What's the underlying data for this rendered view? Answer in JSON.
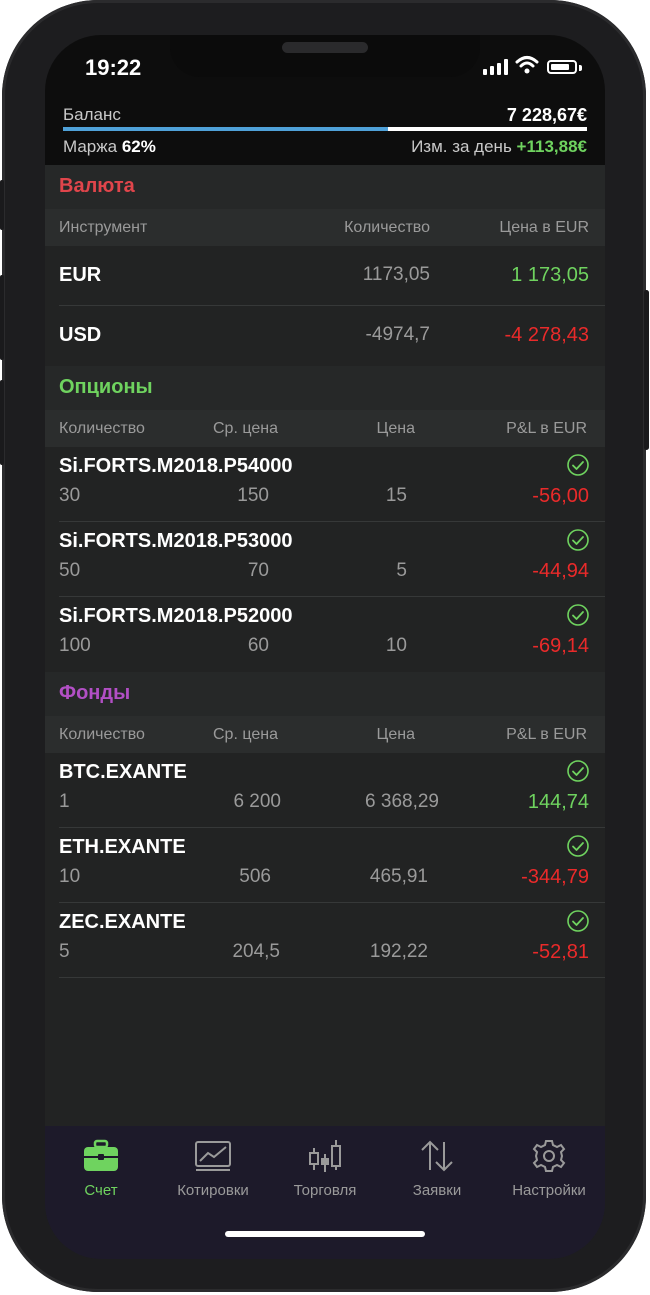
{
  "status": {
    "time": "19:22"
  },
  "balance": {
    "label": "Баланс",
    "value": "7 228,67€",
    "fill_fraction": 0.62
  },
  "margin": {
    "label": "Маржа",
    "value": "62%"
  },
  "day_change": {
    "label": "Изм. за день",
    "value": "+113,88€"
  },
  "currency": {
    "title": "Валюта",
    "headers": {
      "instrument": "Инструмент",
      "quantity": "Количество",
      "price": "Цена в EUR"
    },
    "rows": [
      {
        "name": "EUR",
        "quantity": "1173,05",
        "price": "1 173,05",
        "sign": "pos"
      },
      {
        "name": "USD",
        "quantity": "-4974,7",
        "price": "-4 278,43",
        "sign": "neg"
      }
    ]
  },
  "options": {
    "title": "Опционы",
    "headers": {
      "quantity": "Количество",
      "avg_price": "Ср. цена",
      "price": "Цена",
      "pl": "P&L в EUR"
    },
    "rows": [
      {
        "name": "Si.FORTS.M2018.P54000",
        "quantity": "30",
        "avg_price": "150",
        "price": "15",
        "pl": "-56,00",
        "sign": "neg"
      },
      {
        "name": "Si.FORTS.M2018.P53000",
        "quantity": "50",
        "avg_price": "70",
        "price": "5",
        "pl": "-44,94",
        "sign": "neg"
      },
      {
        "name": "Si.FORTS.M2018.P52000",
        "quantity": "100",
        "avg_price": "60",
        "price": "10",
        "pl": "-69,14",
        "sign": "neg"
      }
    ]
  },
  "funds": {
    "title": "Фонды",
    "headers": {
      "quantity": "Количество",
      "avg_price": "Ср. цена",
      "price": "Цена",
      "pl": "P&L в EUR"
    },
    "rows": [
      {
        "name": "BTC.EXANTE",
        "quantity": "1",
        "avg_price": "6 200",
        "price": "6 368,29",
        "pl": "144,74",
        "sign": "pos"
      },
      {
        "name": "ETH.EXANTE",
        "quantity": "10",
        "avg_price": "506",
        "price": "465,91",
        "pl": "-344,79",
        "sign": "neg"
      },
      {
        "name": "ZEC.EXANTE",
        "quantity": "5",
        "avg_price": "204,5",
        "price": "192,22",
        "pl": "-52,81",
        "sign": "neg"
      }
    ]
  },
  "tabs": [
    {
      "label": "Счет",
      "icon": "briefcase-icon",
      "active": true
    },
    {
      "label": "Котировки",
      "icon": "chart-icon",
      "active": false
    },
    {
      "label": "Торговля",
      "icon": "candlestick-icon",
      "active": false
    },
    {
      "label": "Заявки",
      "icon": "arrows-updown-icon",
      "active": false
    },
    {
      "label": "Настройки",
      "icon": "gear-icon",
      "active": false
    }
  ],
  "colors": {
    "positive": "#6fd35f",
    "negative": "#ea2a2a",
    "currency_title": "#e0454b",
    "options_title": "#6fd35f",
    "funds_title": "#b24fc5",
    "accent_bar": "#4fa1d8"
  }
}
